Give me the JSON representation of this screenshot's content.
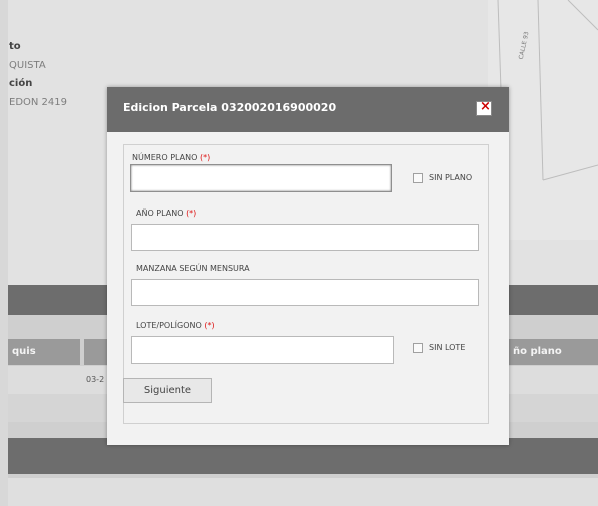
{
  "background": {
    "info_lines": [
      {
        "text": "to"
      },
      {
        "text": "QUISTA"
      },
      {
        "text": "ción"
      },
      {
        "text": "EDON 2419"
      }
    ],
    "map_label": "CALLE 93",
    "table": {
      "left_header": "quis",
      "right_header": "ño plano",
      "row_cell": "03-2"
    }
  },
  "dialog": {
    "title": "Edicion Parcela 032002016900020",
    "close": "×",
    "fields": {
      "numero_plano": {
        "label": "NÚMERO PLANO",
        "required_mark": "(*)",
        "value": "",
        "checkbox_label": "SIN PLANO"
      },
      "anio_plano": {
        "label": "AÑO PLANO",
        "required_mark": "(*)",
        "value": ""
      },
      "manzana": {
        "label": "MANZANA SEGÚN MENSURA",
        "value": ""
      },
      "lote": {
        "label": "LOTE/POLÍGONO",
        "required_mark": "(*)",
        "value": "",
        "checkbox_label": "SIN LOTE"
      }
    },
    "submit": "Siguiente"
  },
  "colors": {
    "title_bar": "#6c6c6c",
    "required": "#dd1111",
    "close_icon": "#cc0000"
  }
}
